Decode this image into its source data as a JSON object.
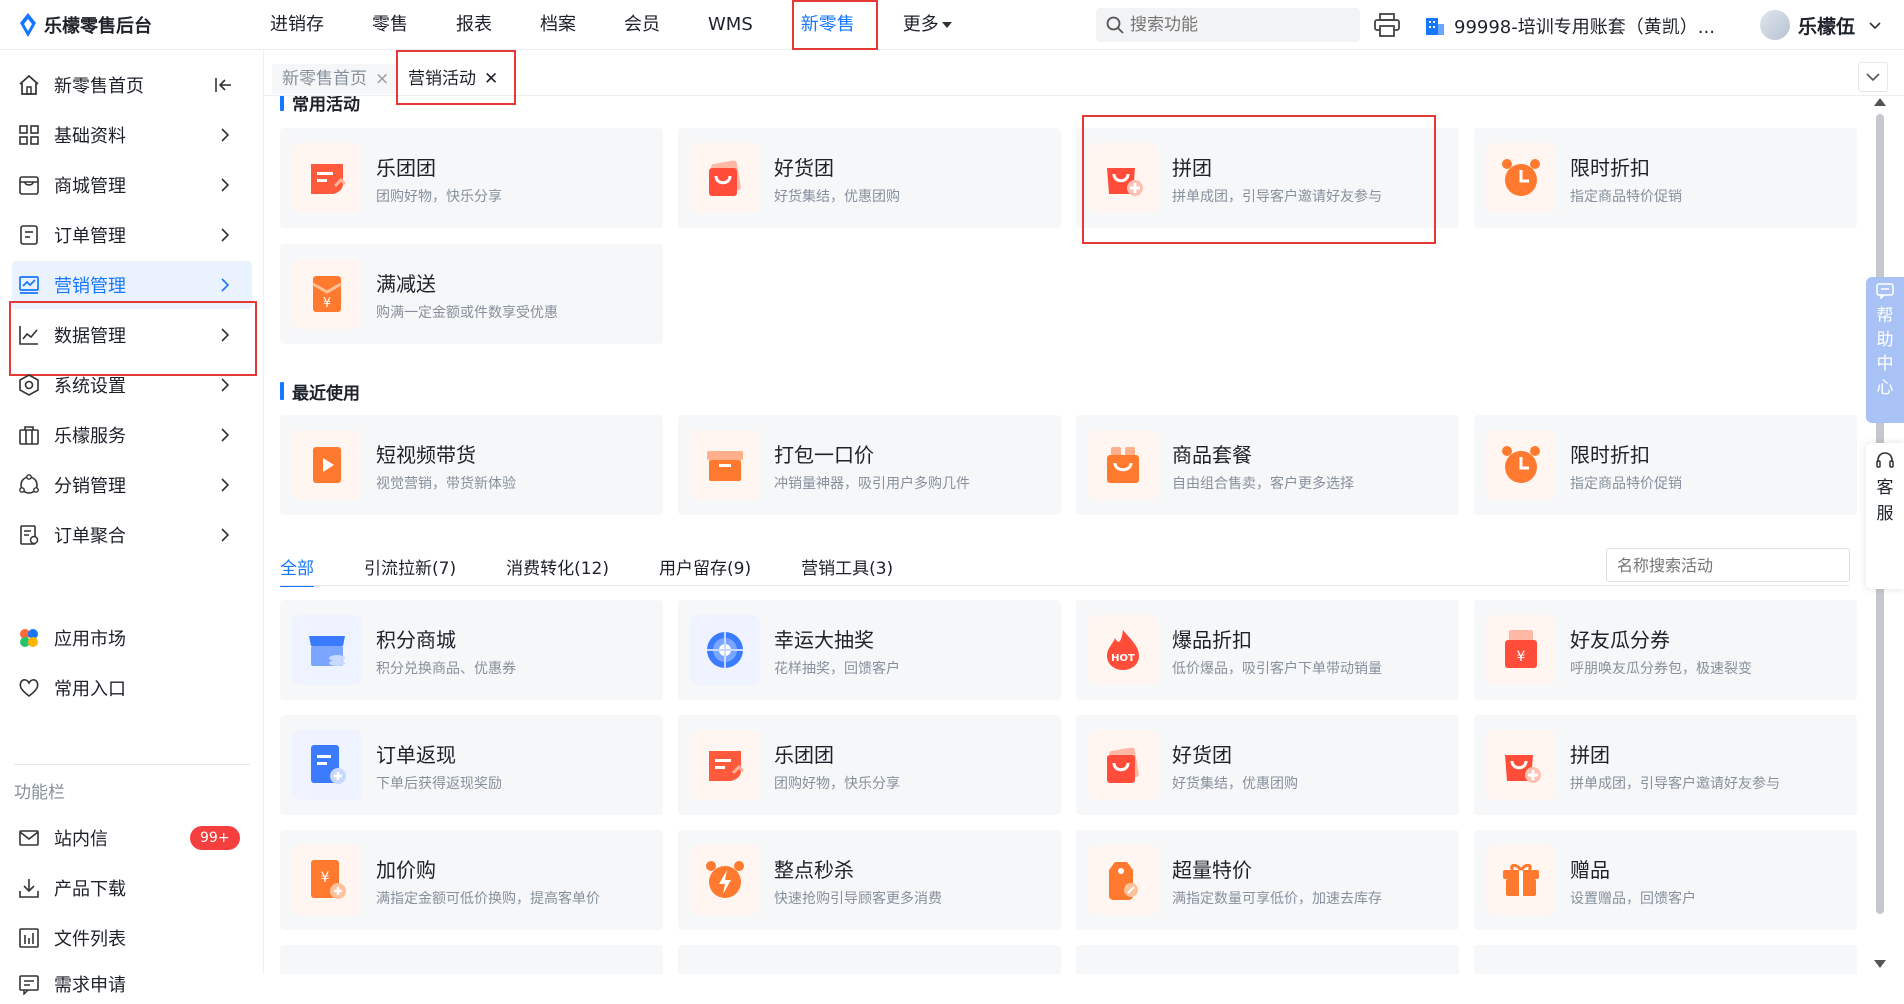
{
  "app": {
    "name": "乐檬零售后台"
  },
  "nav": {
    "items": [
      {
        "label": "进销存"
      },
      {
        "label": "零售"
      },
      {
        "label": "报表"
      },
      {
        "label": "档案"
      },
      {
        "label": "会员"
      },
      {
        "label": "WMS"
      },
      {
        "label": "新零售",
        "active": true
      },
      {
        "label": "更多"
      }
    ]
  },
  "search": {
    "placeholder": "搜索功能"
  },
  "account": {
    "label": "99998-培训专用账套（黄凯）..."
  },
  "user": {
    "name": "乐檬伍"
  },
  "sidebar": {
    "items": [
      {
        "label": "新零售首页",
        "icon": "home-icon"
      },
      {
        "label": "基础资料",
        "icon": "grid-icon"
      },
      {
        "label": "商城管理",
        "icon": "store-icon"
      },
      {
        "label": "订单管理",
        "icon": "order-icon"
      },
      {
        "label": "营销管理",
        "icon": "marketing-icon",
        "active": true
      },
      {
        "label": "数据管理",
        "icon": "chart-icon"
      },
      {
        "label": "系统设置",
        "icon": "settings-icon"
      },
      {
        "label": "乐檬服务",
        "icon": "service-icon"
      },
      {
        "label": "分销管理",
        "icon": "distribution-icon"
      },
      {
        "label": "订单聚合",
        "icon": "aggregate-icon"
      }
    ],
    "extra": [
      {
        "label": "应用市场"
      },
      {
        "label": "常用入口"
      }
    ],
    "func_label": "功能栏",
    "func_items": [
      {
        "label": "站内信",
        "badge": "99+"
      },
      {
        "label": "产品下载"
      },
      {
        "label": "文件列表"
      },
      {
        "label": "需求申请"
      }
    ]
  },
  "page_tabs": [
    {
      "label": "新零售首页",
      "close": "×"
    },
    {
      "label": "营销活动",
      "close": "✕",
      "active": true
    }
  ],
  "sections": {
    "common": "常用活动",
    "recent": "最近使用"
  },
  "common_cards": [
    {
      "title": "乐团团",
      "desc": "团购好物，快乐分享"
    },
    {
      "title": "好货团",
      "desc": "好货集结，优惠团购"
    },
    {
      "title": "拼团",
      "desc": "拼单成团，引导客户邀请好友参与"
    },
    {
      "title": "限时折扣",
      "desc": "指定商品特价促销"
    },
    {
      "title": "满减送",
      "desc": "购满一定金额或件数享受优惠"
    }
  ],
  "recent_cards": [
    {
      "title": "短视频带货",
      "desc": "视觉营销，带货新体验"
    },
    {
      "title": "打包一口价",
      "desc": "冲销量神器，吸引用户多购几件"
    },
    {
      "title": "商品套餐",
      "desc": "自由组合售卖，客户更多选择"
    },
    {
      "title": "限时折扣",
      "desc": "指定商品特价促销"
    }
  ],
  "filter_tabs": [
    {
      "label": "全部",
      "active": true
    },
    {
      "label": "引流拉新(7)"
    },
    {
      "label": "消费转化(12)"
    },
    {
      "label": "用户留存(9)"
    },
    {
      "label": "营销工具(3)"
    }
  ],
  "filter_search": {
    "placeholder": "名称搜索活动"
  },
  "all_cards": [
    {
      "title": "积分商城",
      "desc": "积分兑换商品、优惠券"
    },
    {
      "title": "幸运大抽奖",
      "desc": "花样抽奖，回馈客户"
    },
    {
      "title": "爆品折扣",
      "desc": "低价爆品，吸引客户下单带动销量"
    },
    {
      "title": "好友瓜分券",
      "desc": "呼朋唤友瓜分券包，极速裂变"
    },
    {
      "title": "订单返现",
      "desc": "下单后获得返现奖励"
    },
    {
      "title": "乐团团",
      "desc": "团购好物，快乐分享"
    },
    {
      "title": "好货团",
      "desc": "好货集结，优惠团购"
    },
    {
      "title": "拼团",
      "desc": "拼单成团，引导客户邀请好友参与"
    },
    {
      "title": "加价购",
      "desc": "满指定金额可低价换购，提高客单价"
    },
    {
      "title": "整点秒杀",
      "desc": "快速抢购引导顾客更多消费"
    },
    {
      "title": "超量特价",
      "desc": "满指定数量可享低价，加速去库存"
    },
    {
      "title": "赠品",
      "desc": "设置赠品，回馈客户"
    }
  ],
  "float": {
    "help": [
      "帮",
      "助",
      "中",
      "心"
    ],
    "service": [
      "客",
      "服"
    ]
  },
  "hot_label": "HOT",
  "yen": "¥",
  "colors": {
    "accent": "#1677ff",
    "brand_orange": "#ff6a3d",
    "highlight": "#e53935"
  }
}
